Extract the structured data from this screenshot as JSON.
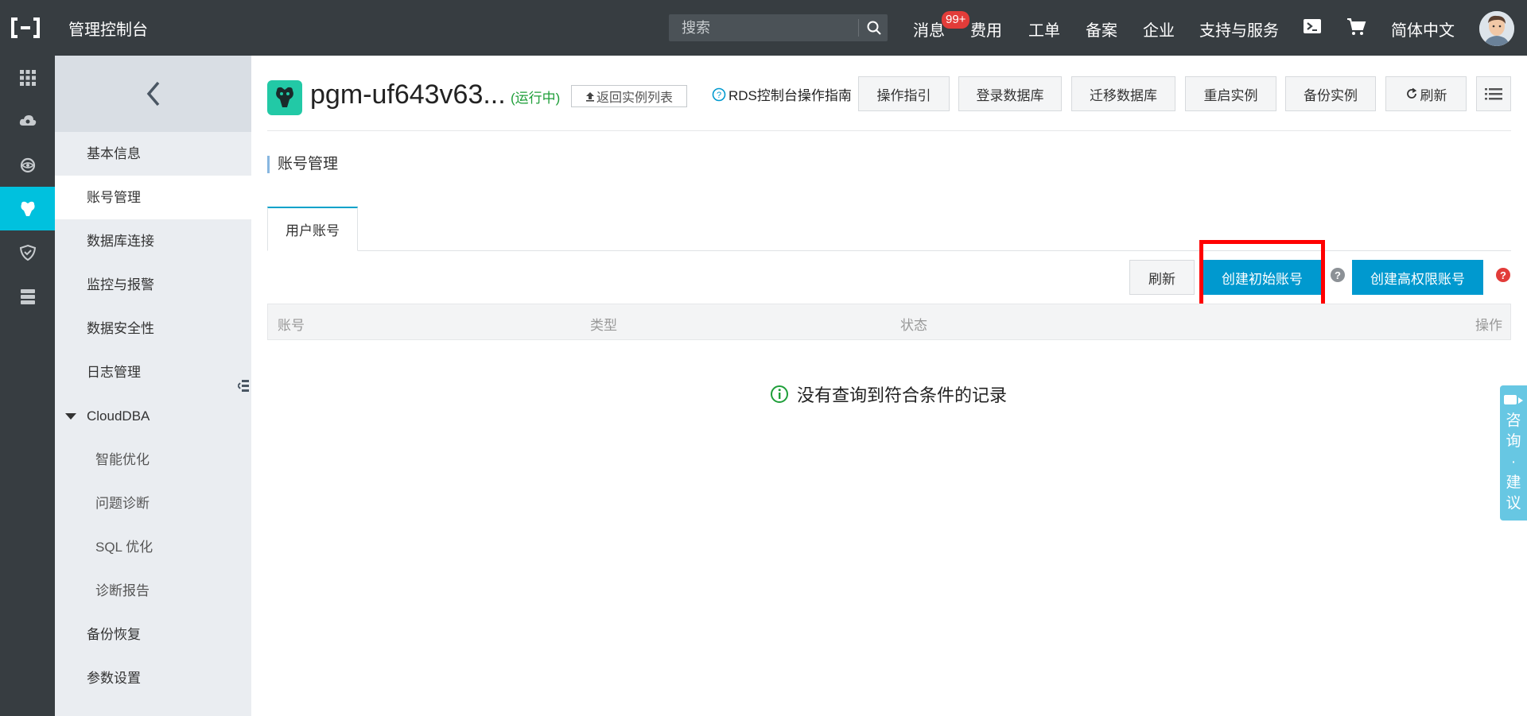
{
  "topbar": {
    "console_title": "管理控制台",
    "search_placeholder": "搜索",
    "nav": {
      "messages": "消息",
      "messages_badge": "99+",
      "billing": "费用",
      "tickets": "工单",
      "filing": "备案",
      "enterprise": "企业",
      "support": "支持与服务",
      "language": "简体中文"
    }
  },
  "sidebar": {
    "items": [
      {
        "label": "基本信息"
      },
      {
        "label": "账号管理"
      },
      {
        "label": "数据库连接"
      },
      {
        "label": "监控与报警"
      },
      {
        "label": "数据安全性"
      },
      {
        "label": "日志管理"
      },
      {
        "label": "CloudDBA"
      },
      {
        "label": "智能优化"
      },
      {
        "label": "问题诊断"
      },
      {
        "label": "SQL 优化"
      },
      {
        "label": "诊断报告"
      },
      {
        "label": "备份恢复"
      },
      {
        "label": "参数设置"
      }
    ]
  },
  "header": {
    "instance_name": "pgm-uf643v63...",
    "status": "(运行中)",
    "back_to_list": "返回实例列表",
    "guide_link": "RDS控制台操作指南",
    "actions": {
      "operation_guide": "操作指引",
      "login_db": "登录数据库",
      "migrate_db": "迁移数据库",
      "restart": "重启实例",
      "backup": "备份实例",
      "refresh": "刷新"
    }
  },
  "main": {
    "section_title": "账号管理",
    "tab_user_accounts": "用户账号",
    "toolbar": {
      "refresh": "刷新",
      "create_initial": "创建初始账号",
      "create_privileged": "创建高权限账号"
    },
    "table_columns": [
      "账号",
      "类型",
      "状态",
      "操作"
    ],
    "empty_message": "没有查询到符合条件的记录"
  },
  "float": {
    "chars": [
      "咨",
      "询",
      "·",
      "建",
      "议"
    ]
  },
  "colors": {
    "topbar_bg": "#373d41",
    "accent": "#00c1de",
    "primary_button": "#0099cf",
    "status_green": "#1e9e39",
    "badge_red": "#e23c39",
    "highlight_red": "#ff0000"
  }
}
